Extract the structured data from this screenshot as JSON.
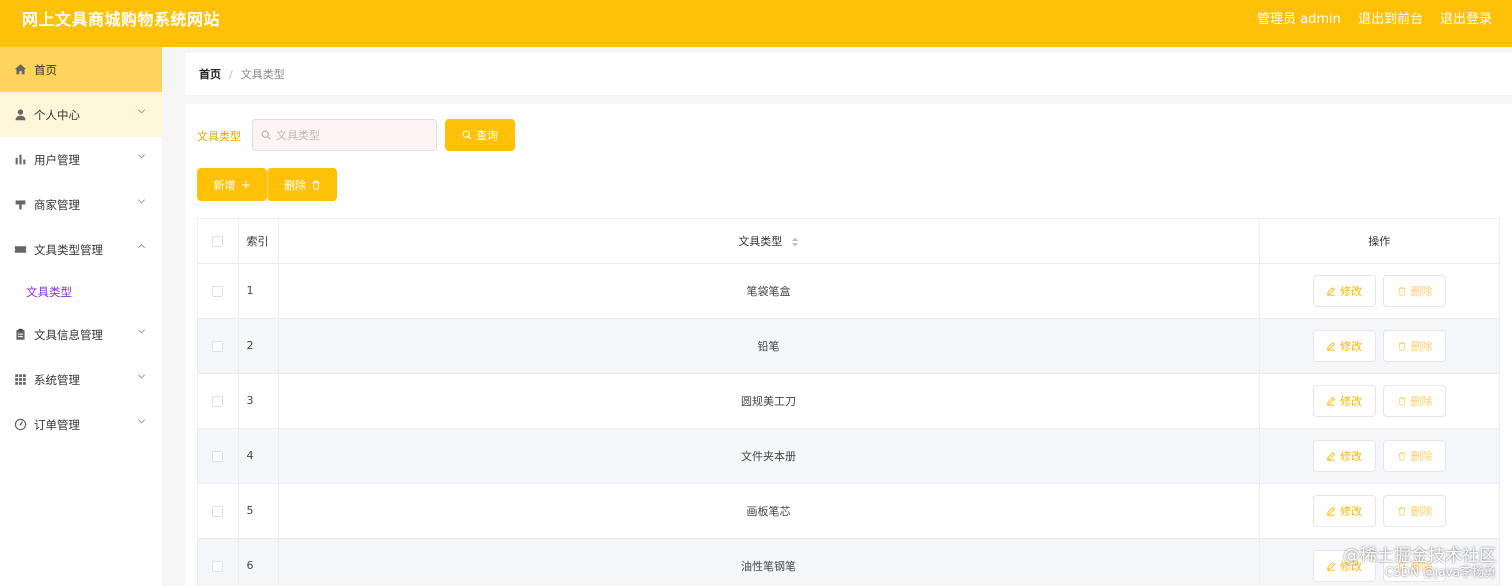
{
  "header": {
    "title": "网上文具商城购物系统网站",
    "user_label": "管理员 admin",
    "frontend_link": "退出到前台",
    "logout_link": "退出登录"
  },
  "sidebar": {
    "items": [
      {
        "label": "首页",
        "icon": "home-icon"
      },
      {
        "label": "个人中心",
        "icon": "user-icon"
      },
      {
        "label": "用户管理",
        "icon": "bar-chart-icon"
      },
      {
        "label": "商家管理",
        "icon": "store-icon"
      },
      {
        "label": "文具类型管理",
        "icon": "ticket-icon"
      },
      {
        "label": "文具信息管理",
        "icon": "clipboard-icon"
      },
      {
        "label": "系统管理",
        "icon": "grid-icon"
      },
      {
        "label": "订单管理",
        "icon": "gauge-icon"
      }
    ],
    "submenu": {
      "label": "文具类型"
    }
  },
  "breadcrumb": {
    "home": "首页",
    "separator": "/",
    "current": "文具类型"
  },
  "search": {
    "label": "文具类型",
    "placeholder": "文具类型",
    "value": "",
    "query_button": "查询"
  },
  "toolbar": {
    "add_label": "新增",
    "delete_label": "删除"
  },
  "table": {
    "columns": {
      "index": "索引",
      "type": "文具类型",
      "ops": "操作"
    },
    "rows": [
      {
        "index": "1",
        "type": "笔袋笔盒"
      },
      {
        "index": "2",
        "type": "铅笔"
      },
      {
        "index": "3",
        "type": "圆规美工刀"
      },
      {
        "index": "4",
        "type": "文件夹本册"
      },
      {
        "index": "5",
        "type": "画板笔芯"
      },
      {
        "index": "6",
        "type": "油性笔钢笔"
      }
    ],
    "edit_label": "修改",
    "delete_label": "删除"
  },
  "watermark": {
    "line1": "@稀土掘金技术社区",
    "line2": "CSDN @java李杨勇"
  },
  "colors": {
    "accent": "#ffc107",
    "submenu_active": "#8a2be2"
  }
}
